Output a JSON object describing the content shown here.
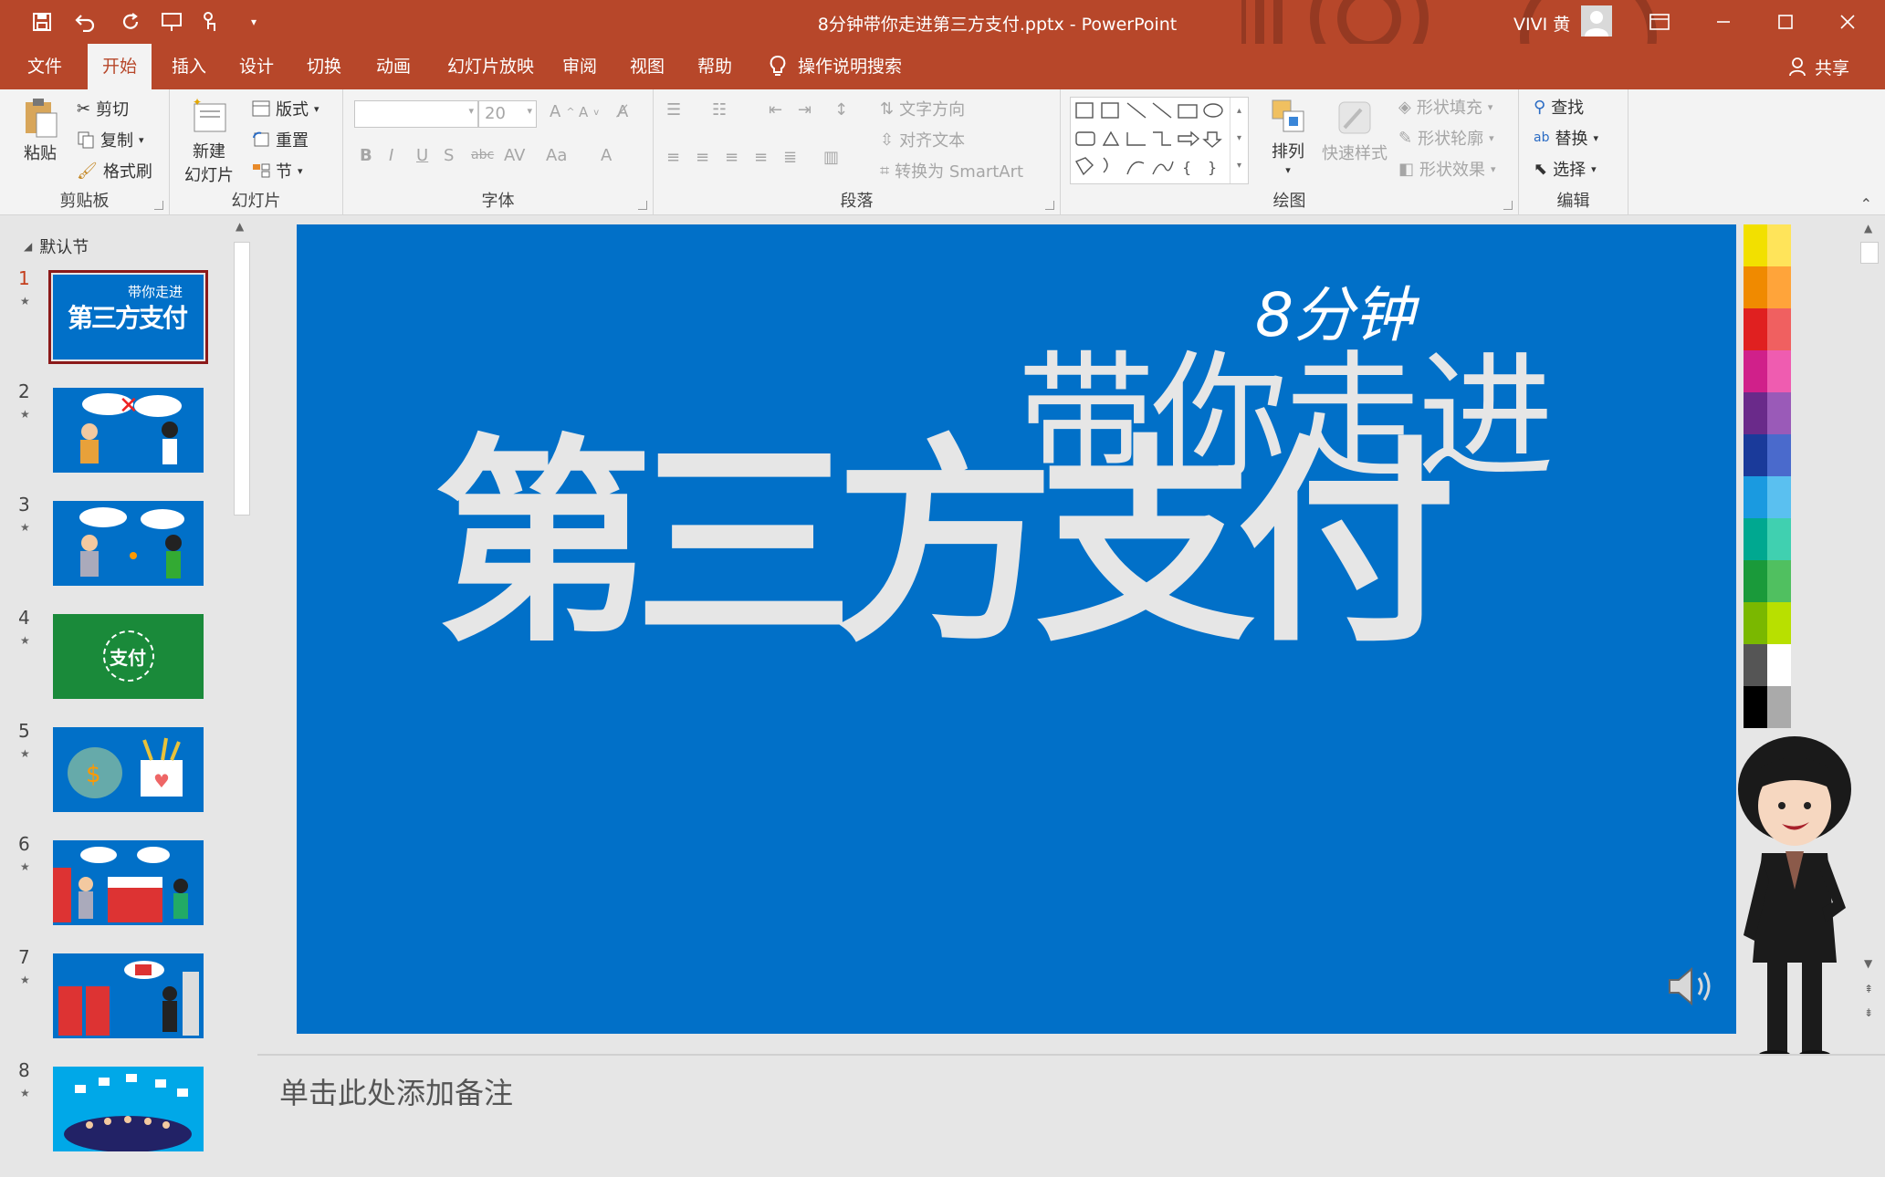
{
  "titlebar": {
    "document_title": "8分钟带你走进第三方支付.pptx  -  PowerPoint",
    "user_name": "VIVI 黄",
    "colors": {
      "brand": "#b7472a"
    }
  },
  "tabs": [
    {
      "label": "文件",
      "active": false
    },
    {
      "label": "开始",
      "active": true
    },
    {
      "label": "插入",
      "active": false
    },
    {
      "label": "设计",
      "active": false
    },
    {
      "label": "切换",
      "active": false
    },
    {
      "label": "动画",
      "active": false
    },
    {
      "label": "幻灯片放映",
      "active": false
    },
    {
      "label": "审阅",
      "active": false
    },
    {
      "label": "视图",
      "active": false
    },
    {
      "label": "帮助",
      "active": false
    }
  ],
  "tell_me": "操作说明搜索",
  "share": "共享",
  "ribbon": {
    "clipboard": {
      "label": "剪贴板",
      "paste": "粘贴",
      "cut": "剪切",
      "copy": "复制",
      "format_painter": "格式刷"
    },
    "slides": {
      "label": "幻灯片",
      "new_slide_line1": "新建",
      "new_slide_line2": "幻灯片",
      "layout": "版式",
      "reset": "重置",
      "section": "节"
    },
    "font": {
      "label": "字体",
      "font_name": "",
      "font_size": "20"
    },
    "paragraph": {
      "label": "段落",
      "text_direction": "文字方向",
      "align_text": "对齐文本",
      "convert_smartart": "转换为 SmartArt"
    },
    "drawing": {
      "label": "绘图",
      "arrange": "排列",
      "quick_styles": "快速样式",
      "shape_fill": "形状填充",
      "shape_outline": "形状轮廓",
      "shape_effects": "形状效果"
    },
    "editing": {
      "label": "编辑",
      "find": "查找",
      "replace": "替换",
      "select": "选择"
    }
  },
  "thumbnails": {
    "section": "默认节",
    "slides": [
      {
        "number": "1",
        "active": true,
        "title_small": "带你走进",
        "title_big": "第三方支付",
        "bg": "#0170c8"
      },
      {
        "number": "2",
        "active": false,
        "bg": "#0170c8"
      },
      {
        "number": "3",
        "active": false,
        "bg": "#0170c8"
      },
      {
        "number": "4",
        "active": false,
        "title_big": "支付",
        "bg": "#1a8a3a"
      },
      {
        "number": "5",
        "active": false,
        "bg": "#0170c8"
      },
      {
        "number": "6",
        "active": false,
        "bg": "#0170c8"
      },
      {
        "number": "7",
        "active": false,
        "bg": "#0170c8"
      },
      {
        "number": "8",
        "active": false,
        "bg": "#00a8e8"
      }
    ]
  },
  "slide": {
    "prefix": "8分钟",
    "subtitle": "带你走进",
    "title": "第三方支付",
    "bg_color": "#0170c8"
  },
  "notes": {
    "placeholder": "单击此处添加备注"
  }
}
